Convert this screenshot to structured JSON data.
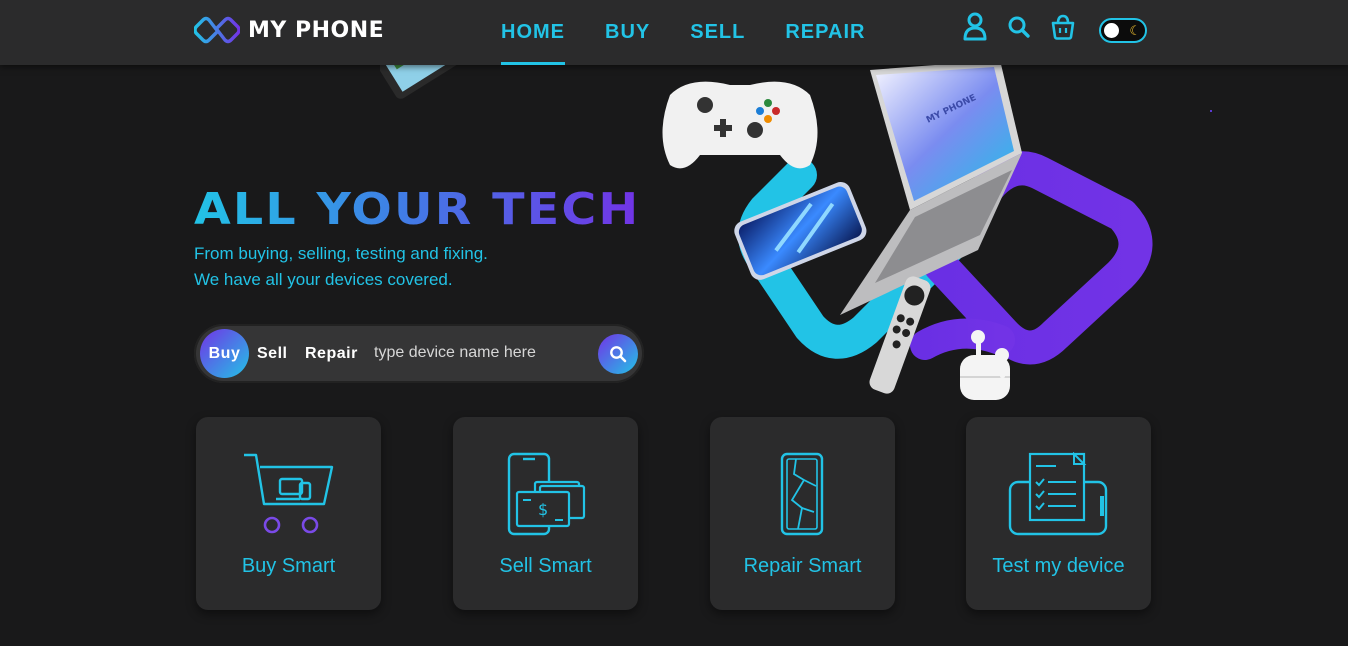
{
  "brand": {
    "name": "MY PHONE"
  },
  "nav": {
    "links": [
      {
        "label": "HOME",
        "active": true
      },
      {
        "label": "BUY"
      },
      {
        "label": "SELL"
      },
      {
        "label": "REPAIR"
      }
    ],
    "icons": [
      "user-icon",
      "search-icon",
      "basket-icon"
    ],
    "theme_toggle": {
      "state": "dark",
      "icons": [
        "sun-icon",
        "moon-icon"
      ]
    }
  },
  "hero": {
    "title": "ALL YOUR TECH",
    "subtitle_line1": "From buying, selling, testing and fixing.",
    "subtitle_line2": "We have all your devices covered."
  },
  "search": {
    "tabs": [
      "Buy",
      "Sell",
      "Repair"
    ],
    "active_tab": "Buy",
    "placeholder": "type device name here",
    "value": ""
  },
  "hero_logo_text": "MY PHONE",
  "cards": [
    {
      "label": "Buy Smart",
      "icon": "cart-icon"
    },
    {
      "label": "Sell Smart",
      "icon": "phone-cash-icon"
    },
    {
      "label": "Repair Smart",
      "icon": "broken-phone-icon"
    },
    {
      "label": "Test my device",
      "icon": "checklist-icon"
    }
  ],
  "colors": {
    "background": "#19191a",
    "navbar": "#2b2b2c",
    "accent_cyan": "#22c3e6",
    "accent_purple": "#7233e6",
    "card": "#2b2b2c"
  }
}
